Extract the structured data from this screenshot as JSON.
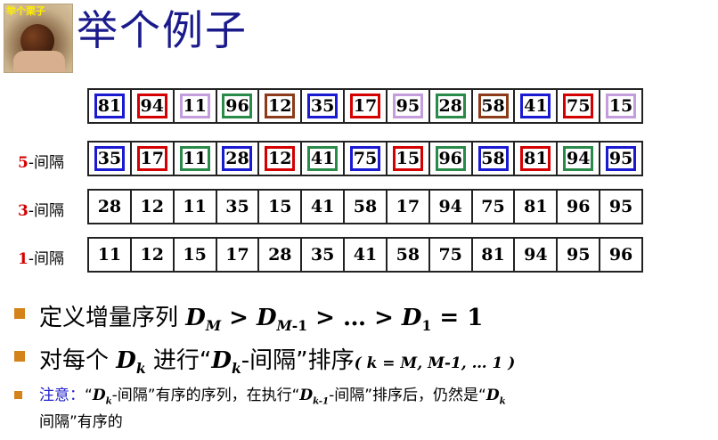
{
  "logo_caption": "举个栗子",
  "title": "举个例子",
  "rows": [
    {
      "label_num": "",
      "label_text": "",
      "cells": [
        "81",
        "94",
        "11",
        "96",
        "12",
        "35",
        "17",
        "95",
        "28",
        "58",
        "41",
        "75",
        "15"
      ],
      "boxes": [
        "#1a1ad0",
        "#d40000",
        "#c39ddc",
        "#2a8a4a",
        "#8b3a1a",
        "#1a1ad0",
        "#d40000",
        "#c39ddc",
        "#2a8a4a",
        "#8b3a1a",
        "#1a1ad0",
        "#d40000",
        "#c39ddc"
      ]
    },
    {
      "label_num": "5",
      "label_text": "-间隔",
      "cells": [
        "35",
        "17",
        "11",
        "28",
        "12",
        "41",
        "75",
        "15",
        "96",
        "58",
        "81",
        "94",
        "95"
      ],
      "boxes": [
        "#1a1ad0",
        "#d40000",
        "#2a8a4a",
        "#1a1ad0",
        "#d40000",
        "#2a8a4a",
        "#1a1ad0",
        "#d40000",
        "#2a8a4a",
        "#1a1ad0",
        "#d40000",
        "#2a8a4a",
        "#1a1ad0"
      ]
    },
    {
      "label_num": "3",
      "label_text": "-间隔",
      "cells": [
        "28",
        "12",
        "11",
        "35",
        "15",
        "41",
        "58",
        "17",
        "94",
        "75",
        "81",
        "96",
        "95"
      ],
      "boxes": []
    },
    {
      "label_num": "1",
      "label_text": "-间隔",
      "cells": [
        "11",
        "12",
        "15",
        "17",
        "28",
        "35",
        "41",
        "58",
        "75",
        "81",
        "94",
        "95",
        "96"
      ],
      "boxes": []
    }
  ],
  "bullets": {
    "b1_text": "定义增量序列",
    "b1_d": "D",
    "b1_m": "M",
    "b1_gt1": " > ",
    "b1_d2": "D",
    "b1_m1": "M",
    "b1_m1b": "-1",
    "b1_rest": " > … > ",
    "b1_d3": "D",
    "b1_1": "1",
    "b1_eq": " = 1",
    "b2_text1": "对每个",
    "b2_dk": "D",
    "b2_k": "k",
    "b2_text2": "进行“",
    "b2_dk2": "D",
    "b2_k2": "k",
    "b2_text3": "-间隔”排序",
    "b2_paren": "( k = M, M-1, … 1 )",
    "b3_note": "注意：",
    "b3_t1": "“",
    "b3_dk": "D",
    "b3_k": "k",
    "b3_t2": "-间隔”有序的序列，在执行“",
    "b3_dk1": "D",
    "b3_k1": "k-1",
    "b3_t3": "-间隔”排序后，仍然是“",
    "b3_dk2": "D",
    "b3_k2": "k",
    "b3_t4": "-",
    "b3_t5": "间隔”有序的"
  },
  "colors": {
    "title": "#1a1a8c",
    "label_num": "#d40000",
    "bullet": "#d4821a",
    "note": "#2222cc"
  }
}
